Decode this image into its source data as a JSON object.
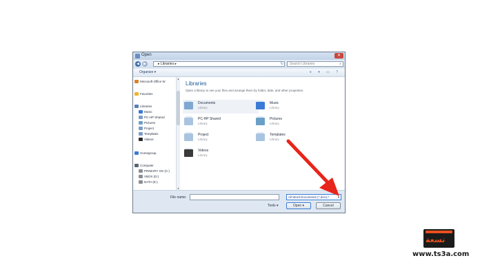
{
  "window": {
    "title": "Open",
    "close_glyph": "✕"
  },
  "address": {
    "back_glyph": "◀",
    "forward_glyph": "▶",
    "path": "▸ Libraries ▸",
    "refresh_glyph": "↻",
    "search_placeholder": "Search Libraries",
    "search_icon": "⌕"
  },
  "toolbar": {
    "organize_label": "Organize ▾",
    "icons_text": "≡ ▾ ▭ ?"
  },
  "navpane": {
    "items": [
      {
        "label": "Microsoft Office W",
        "icon": "office-icon",
        "color": "#d9822b"
      },
      {
        "label": "Favorites",
        "icon": "star-icon",
        "color": "#f0b429"
      },
      {
        "label": "Libraries",
        "icon": "library-icon",
        "color": "#5a7fb0"
      },
      {
        "label": "Music",
        "icon": "music-icon",
        "color": "#3a7bd5"
      },
      {
        "label": "PC-HP Shared",
        "icon": "library-icon",
        "color": "#7a9cc6"
      },
      {
        "label": "Pictures",
        "icon": "pictures-icon",
        "color": "#6aa0c8"
      },
      {
        "label": "Project",
        "icon": "library-icon",
        "color": "#7a9cc6"
      },
      {
        "label": "Templates",
        "icon": "library-icon",
        "color": "#7a9cc6"
      },
      {
        "label": "Videos",
        "icon": "video-icon",
        "color": "#2b2b2b"
      },
      {
        "label": "Homegroup",
        "icon": "homegroup-icon",
        "color": "#3a7bd5"
      },
      {
        "label": "Computer",
        "icon": "computer-icon",
        "color": "#5a6570"
      },
      {
        "label": "PRIMARY OS (C:)",
        "icon": "drive-icon",
        "color": "#8a8f96"
      },
      {
        "label": "VBOX (D:)",
        "icon": "drive-icon",
        "color": "#8a8f96"
      },
      {
        "label": "DATA (E:)",
        "icon": "drive-icon",
        "color": "#8a8f96"
      }
    ]
  },
  "content": {
    "title": "Libraries",
    "description": "Open a library to see your files and arrange them by folder, date, and other properties.",
    "libraries": [
      {
        "name": "Documents",
        "type": "Library",
        "icon": "documents-icon"
      },
      {
        "name": "Music",
        "type": "Library",
        "icon": "music-icon"
      },
      {
        "name": "PC-HP Shared",
        "type": "Library",
        "icon": "library-icon"
      },
      {
        "name": "Pictures",
        "type": "Library",
        "icon": "pictures-icon"
      },
      {
        "name": "Project",
        "type": "Library",
        "icon": "library-icon"
      },
      {
        "name": "Templates",
        "type": "Library",
        "icon": "library-icon"
      },
      {
        "name": "Videos",
        "type": "Library",
        "icon": "video-icon"
      }
    ]
  },
  "footer": {
    "filename_label": "File name:",
    "filename_value": "",
    "filetype_value": "All Word Documents (*.docx;*.",
    "filetype_arrow": "▾",
    "tools_label": "Tools ▾",
    "open_label": "Open ▾",
    "cancel_label": "Cancel"
  },
  "branding": {
    "site": "www.ts3a.com"
  },
  "colors": {
    "arrow": "#e8251a",
    "accent": "#3a7bd5"
  }
}
